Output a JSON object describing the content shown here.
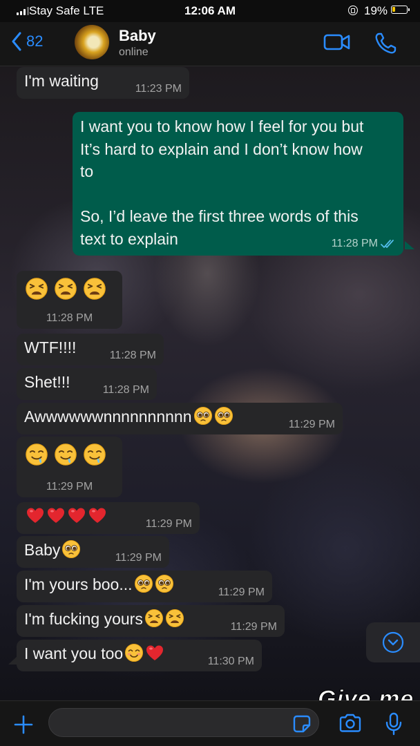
{
  "status_bar": {
    "carrier": "Stay Safe  LTE",
    "time": "12:06 AM",
    "battery": "19%"
  },
  "header": {
    "back_count": "82",
    "contact_name": "Baby",
    "contact_status": "online"
  },
  "messages": [
    {
      "dir": "in",
      "text": "I'm waiting",
      "time": "11:23 PM"
    },
    {
      "dir": "out",
      "lines": [
        "I want you to know how I feel for you but",
        "It’s hard to explain and I don’t know how",
        "to",
        "",
        "So, I’d leave the first three words of this",
        "text to explain"
      ],
      "time": "11:28 PM",
      "status": "read"
    },
    {
      "dir": "in",
      "text": "",
      "emojis": [
        "tired-face",
        "tired-face",
        "tired-face"
      ],
      "time": "11:28 PM"
    },
    {
      "dir": "in",
      "text": "WTF!!!!",
      "time": "11:28 PM"
    },
    {
      "dir": "in",
      "text": "Shet!!!",
      "time": "11:28 PM"
    },
    {
      "dir": "in",
      "text": "Awwwwwwnnnnnnnnnn",
      "emojis": [
        "pleading-face",
        "pleading-face"
      ],
      "time": "11:29 PM"
    },
    {
      "dir": "in",
      "text": "",
      "emojis": [
        "drooling-face",
        "drooling-face",
        "drooling-face"
      ],
      "time": "11:29 PM"
    },
    {
      "dir": "in",
      "text": "",
      "emojis": [
        "red-heart",
        "red-heart",
        "red-heart",
        "red-heart"
      ],
      "time": "11:29 PM"
    },
    {
      "dir": "in",
      "text": "Baby",
      "emojis": [
        "pleading-face"
      ],
      "time": "11:29 PM"
    },
    {
      "dir": "in",
      "text": "I'm yours boo...",
      "emojis": [
        "pleading-face",
        "pleading-face"
      ],
      "time": "11:29 PM"
    },
    {
      "dir": "in",
      "text": "I'm fucking yours",
      "emojis": [
        "tired-face",
        "tired-face"
      ],
      "time": "11:29 PM"
    },
    {
      "dir": "in",
      "text": "I want you too",
      "emojis": [
        "smiling-face",
        "red-heart"
      ],
      "time": "11:30 PM"
    }
  ],
  "overlay_text": "Give me",
  "input": {
    "placeholder": "",
    "value": ""
  },
  "colors": {
    "accent": "#2a8cff",
    "incoming": "#262628",
    "outgoing": "#005c4b",
    "read_ticks": "#53bdeb"
  },
  "icons": [
    "back-chevron-icon",
    "video-call-icon",
    "phone-icon",
    "chevron-down-icon",
    "plus-icon",
    "sticker-icon",
    "camera-icon",
    "microphone-icon"
  ]
}
